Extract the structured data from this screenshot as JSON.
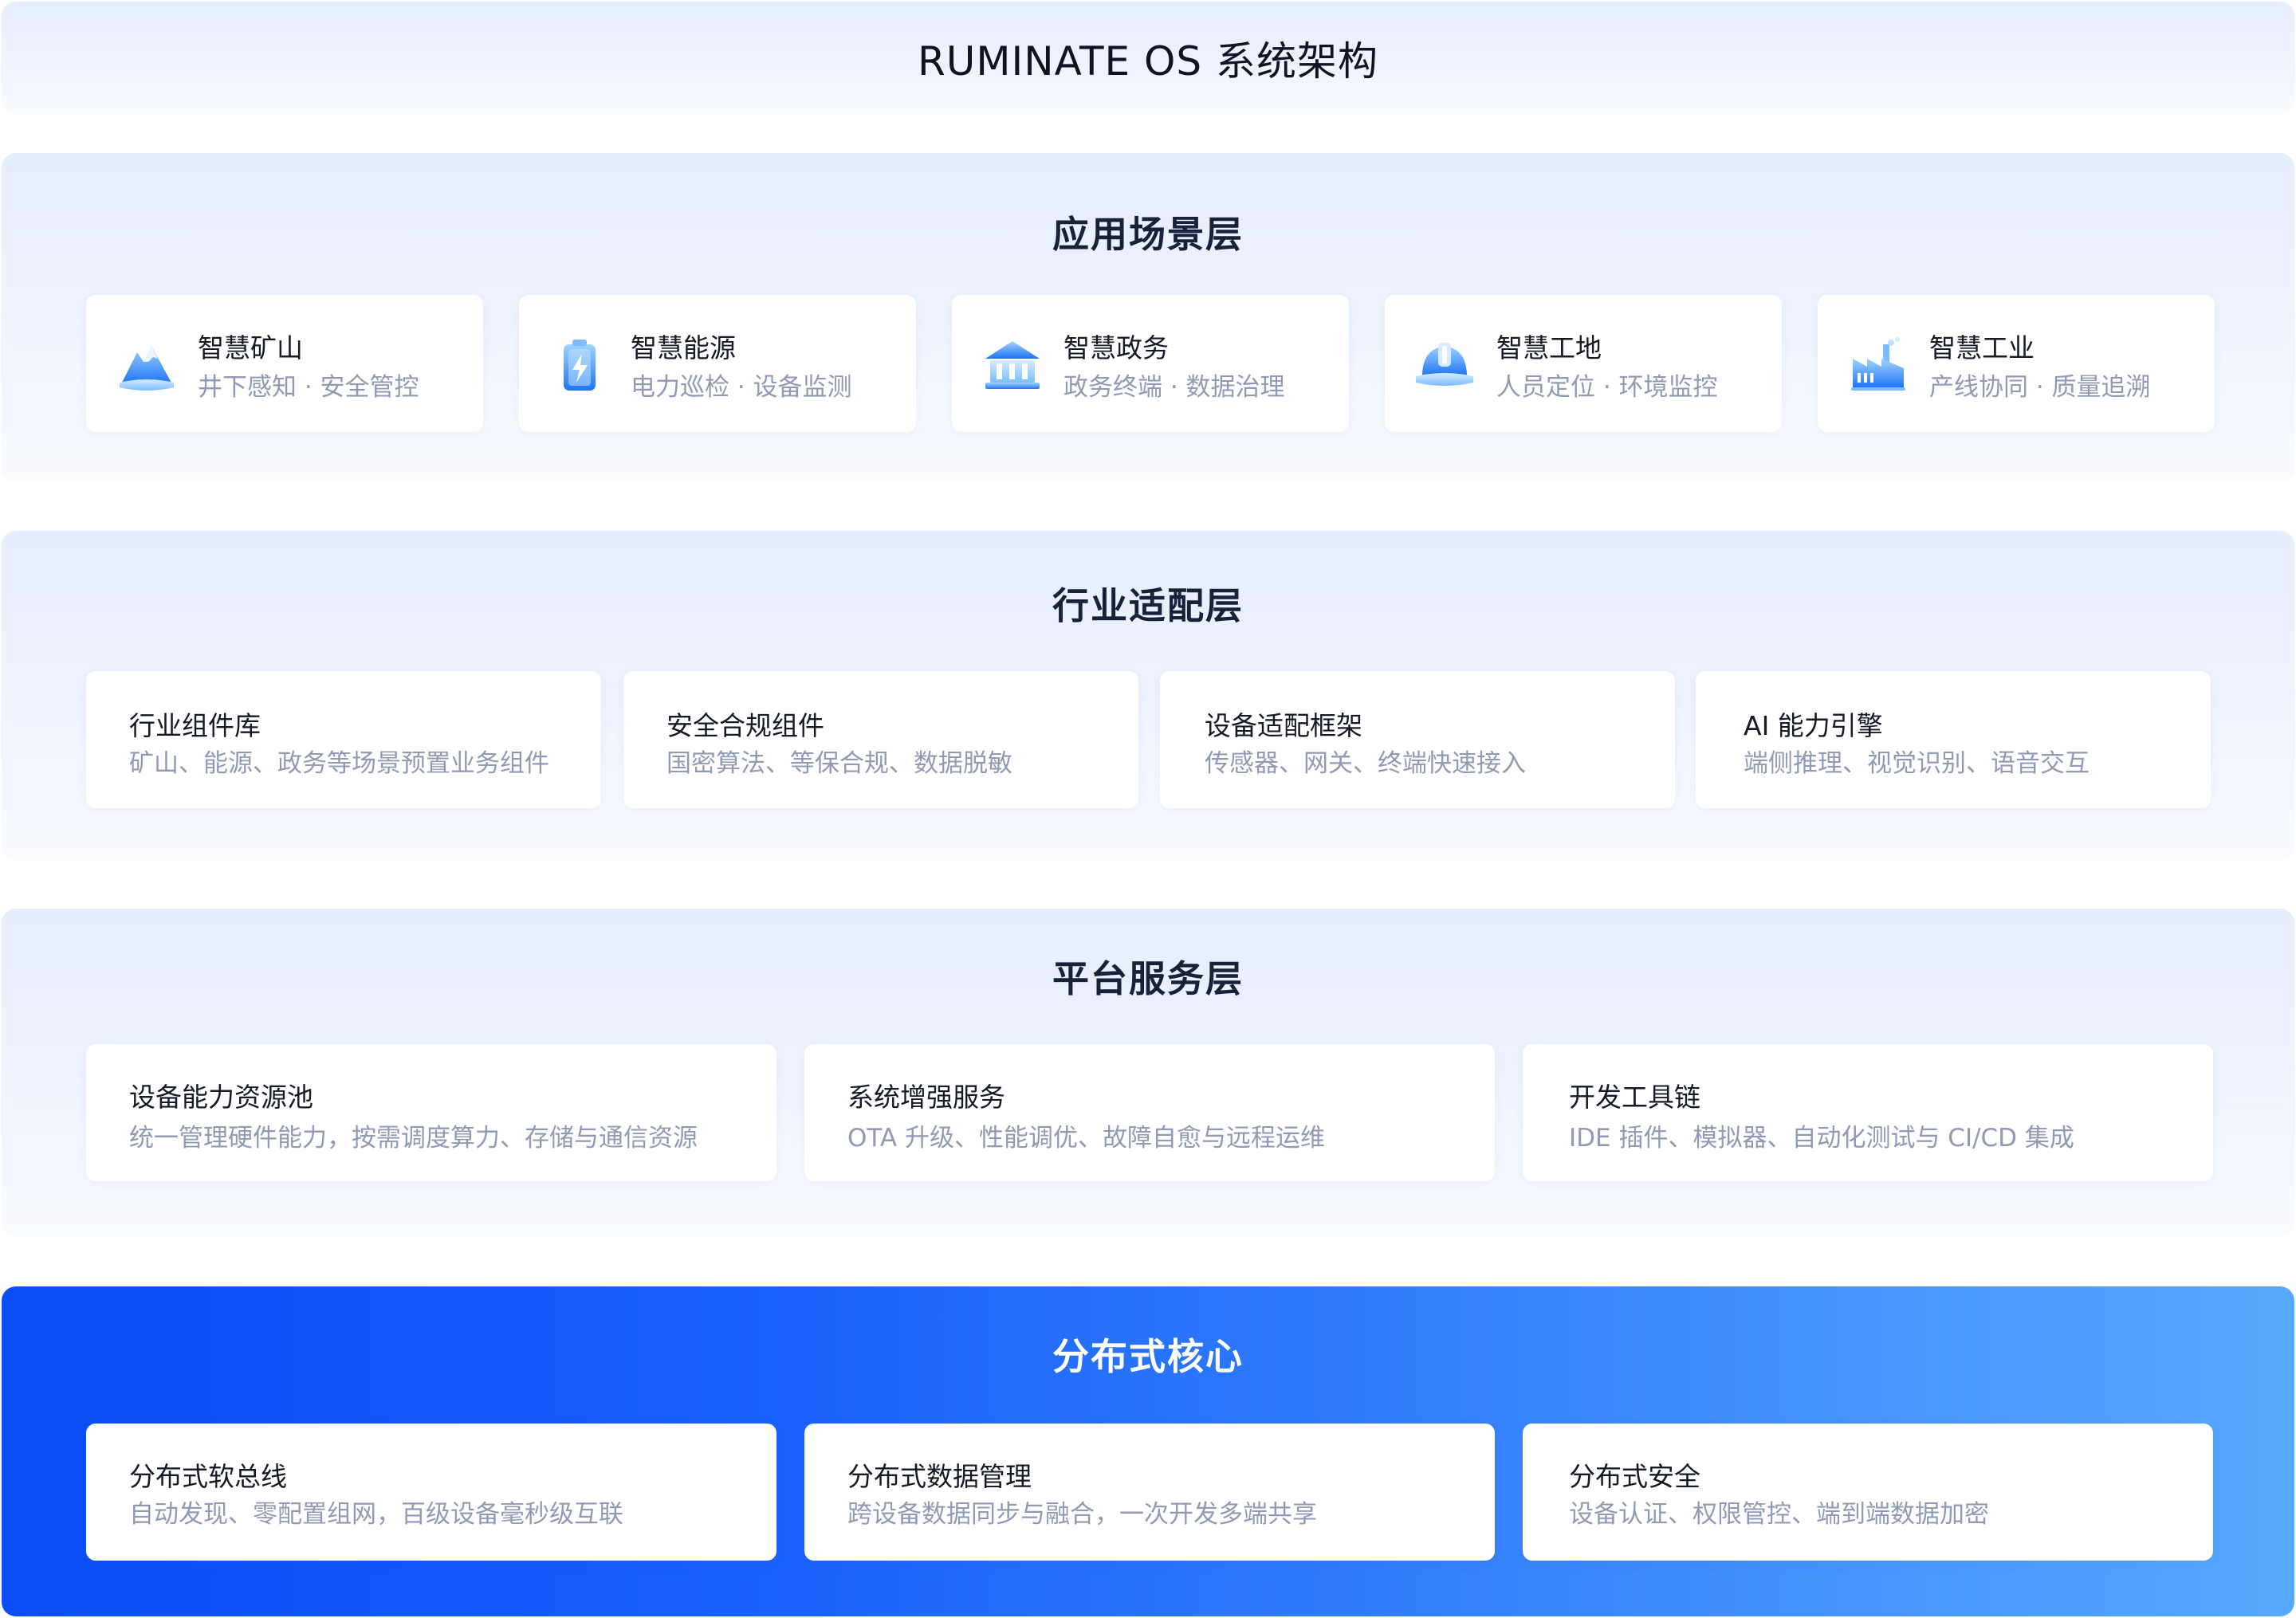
{
  "header": {
    "title": "RUMINATE OS 系统架构"
  },
  "layers": [
    {
      "title": "应用场景层",
      "cards": [
        {
          "title": "智慧矿山",
          "sub": "井下感知 · 安全管控",
          "icon": "mountain-icon"
        },
        {
          "title": "智慧能源",
          "sub": "电力巡检 · 设备监测",
          "icon": "battery-icon"
        },
        {
          "title": "智慧政务",
          "sub": "政务终端 · 数据治理",
          "icon": "government-building-icon"
        },
        {
          "title": "智慧工地",
          "sub": "人员定位 · 环境监控",
          "icon": "hard-hat-icon"
        },
        {
          "title": "智慧工业",
          "sub": "产线协同 · 质量追溯",
          "icon": "factory-icon"
        }
      ]
    },
    {
      "title": "行业适配层",
      "cards": [
        {
          "title": "行业组件库",
          "sub": "矿山、能源、政务等场景预置业务组件"
        },
        {
          "title": "安全合规组件",
          "sub": "国密算法、等保合规、数据脱敏"
        },
        {
          "title": "设备适配框架",
          "sub": "传感器、网关、终端快速接入"
        },
        {
          "title": "AI 能力引擎",
          "sub": "端侧推理、视觉识别、语音交互"
        }
      ]
    },
    {
      "title": "平台服务层",
      "cards": [
        {
          "title": "设备能力资源池",
          "sub": "统一管理硬件能力，按需调度算力、存储与通信资源"
        },
        {
          "title": "系统增强服务",
          "sub": "OTA 升级、性能调优、故障自愈与远程运维"
        },
        {
          "title": "开发工具链",
          "sub": "IDE 插件、模拟器、自动化测试与 CI/CD 集成"
        }
      ]
    },
    {
      "title": "分布式核心",
      "cards": [
        {
          "title": "分布式软总线",
          "sub": "自动发现、零配置组网，百级设备毫秒级互联"
        },
        {
          "title": "分布式数据管理",
          "sub": "跨设备数据同步与融合，一次开发多端共享"
        },
        {
          "title": "分布式安全",
          "sub": "设备认证、权限管控、端到端数据加密"
        }
      ]
    }
  ],
  "colors": {
    "accent_blue": "#1a62fb",
    "core_gradient_start": "#0a4df6",
    "core_gradient_end": "#57a9fe",
    "title_text": "#141a26",
    "sub_text": "#8f9bb5"
  }
}
